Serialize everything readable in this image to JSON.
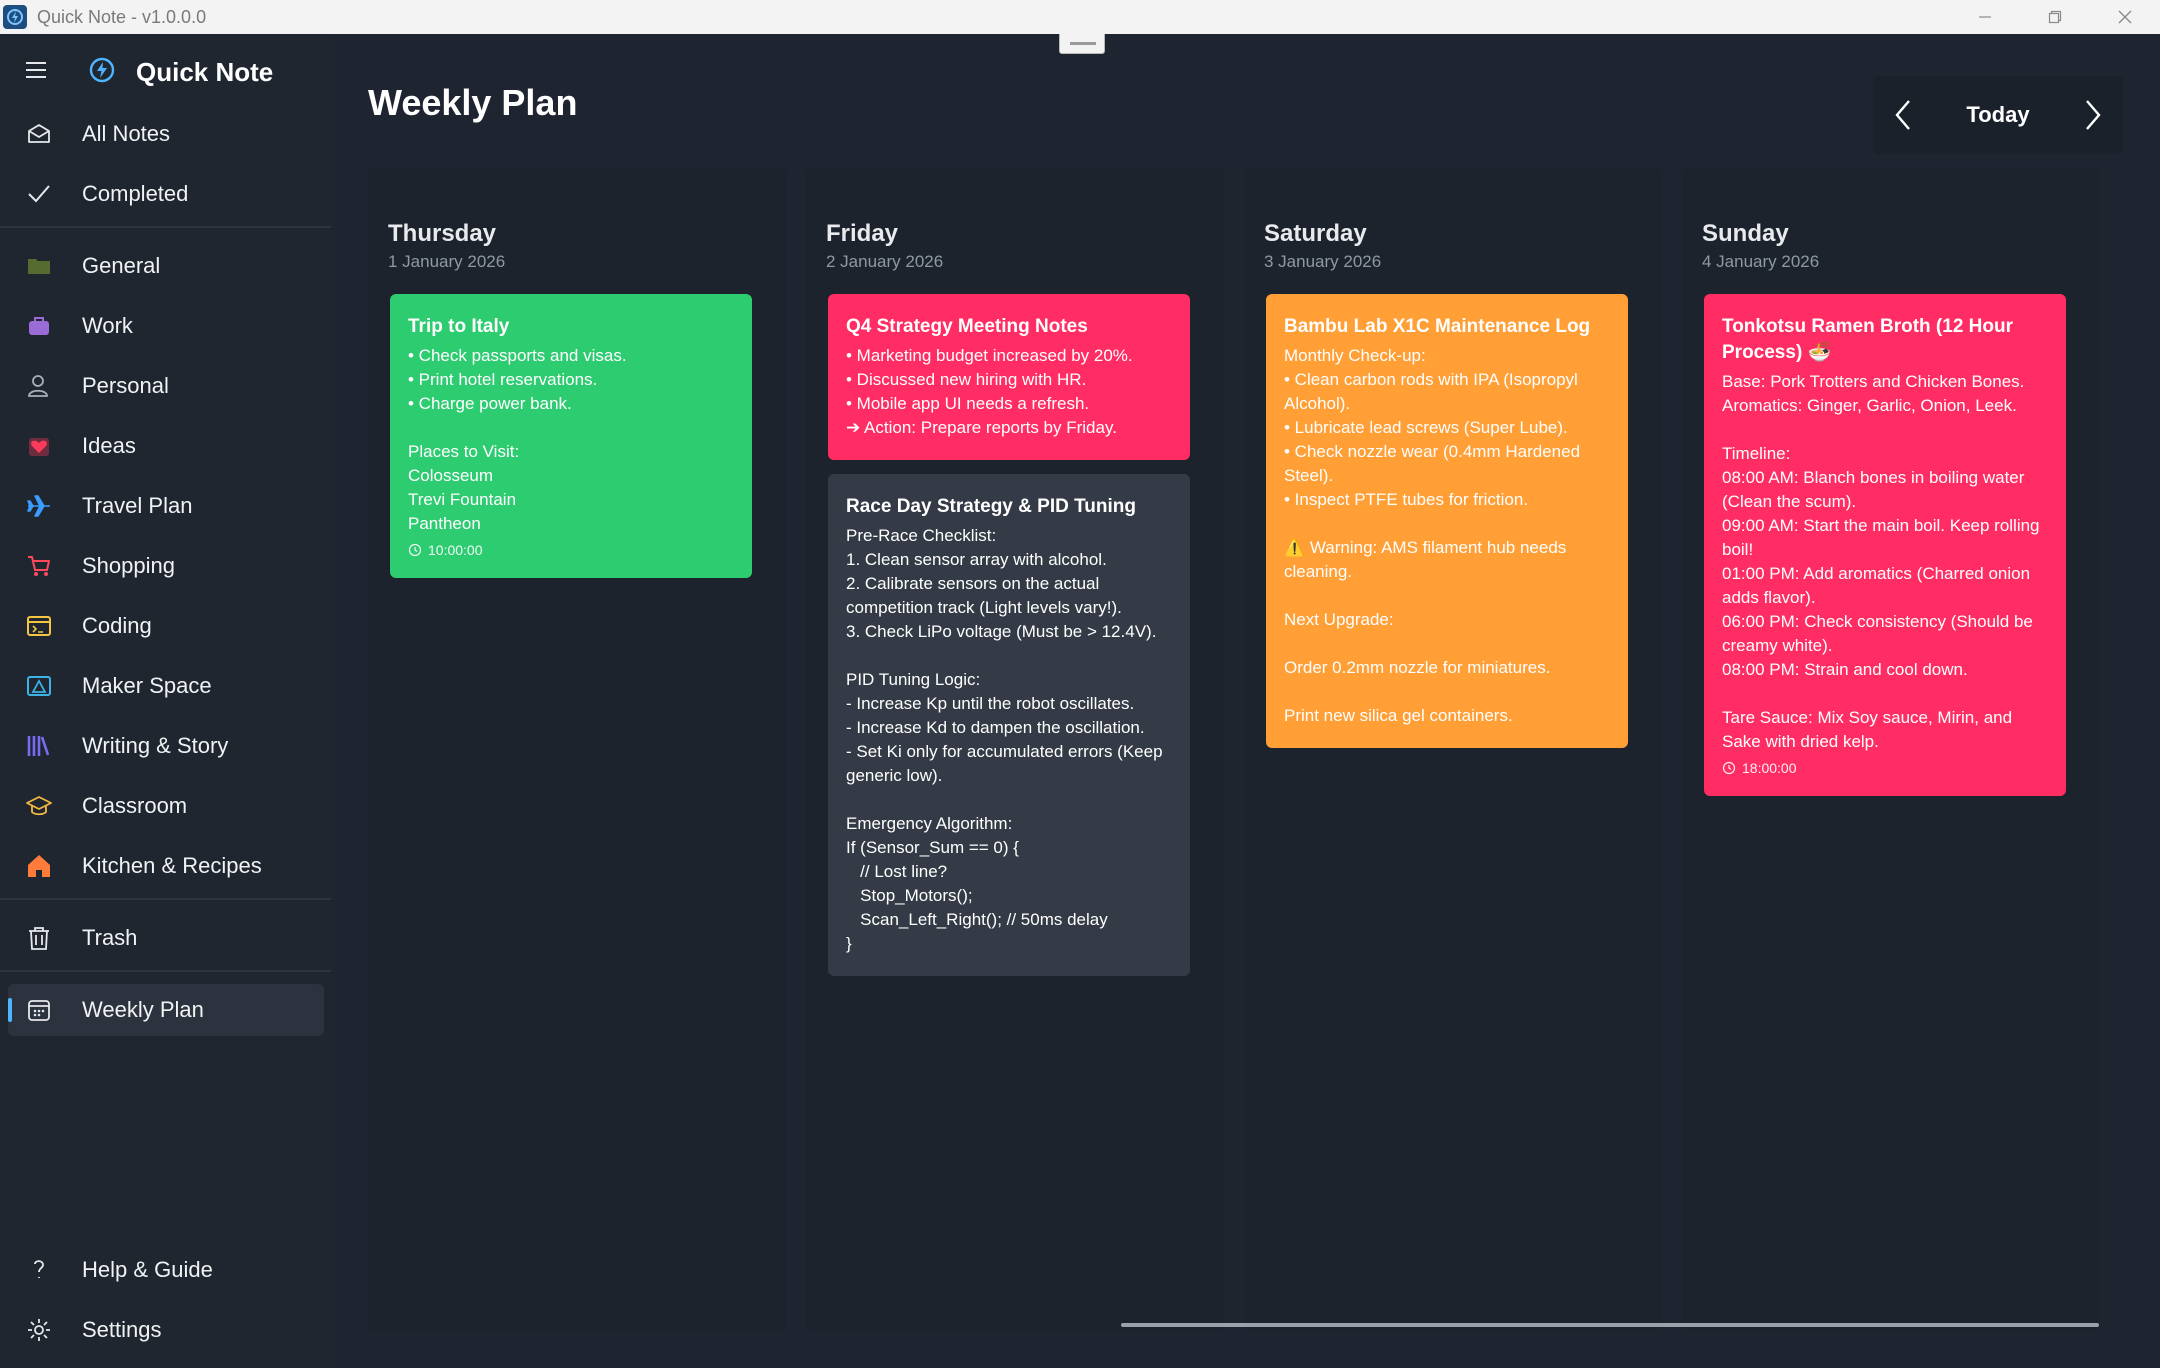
{
  "window": {
    "title": "Quick Note - v1.0.0.0"
  },
  "sidebar": {
    "brand": "Quick Note",
    "items_top": [
      {
        "label": "All Notes",
        "icon": "envelope-icon"
      },
      {
        "label": "Completed",
        "icon": "checkmark-icon"
      }
    ],
    "categories": [
      {
        "label": "General",
        "icon": "folder-icon",
        "color": "#556b2f"
      },
      {
        "label": "Work",
        "icon": "briefcase-icon",
        "color": "#9b6bd6"
      },
      {
        "label": "Personal",
        "icon": "user-icon",
        "color": "#aab0b8"
      },
      {
        "label": "Ideas",
        "icon": "heart-icon",
        "color": "#ff3b5c"
      },
      {
        "label": "Travel Plan",
        "icon": "airplane-icon",
        "color": "#3b9cff"
      },
      {
        "label": "Shopping",
        "icon": "cart-icon",
        "color": "#ff4a5a"
      },
      {
        "label": "Coding",
        "icon": "terminal-icon",
        "color": "#f5c542"
      },
      {
        "label": "Maker Space",
        "icon": "ruler-icon",
        "color": "#3bb3e6"
      },
      {
        "label": "Writing & Story",
        "icon": "books-icon",
        "color": "#7a6cf0"
      },
      {
        "label": "Classroom",
        "icon": "graduation-cap-icon",
        "color": "#f5b942"
      },
      {
        "label": "Kitchen & Recipes",
        "icon": "home-icon",
        "color": "#ff7b3a"
      }
    ],
    "trash": {
      "label": "Trash",
      "icon": "trash-icon"
    },
    "weekly": {
      "label": "Weekly Plan",
      "icon": "calendar-icon"
    },
    "help": {
      "label": "Help & Guide",
      "icon": "question-icon"
    },
    "settings": {
      "label": "Settings",
      "icon": "gear-icon"
    }
  },
  "main": {
    "title": "Weekly Plan",
    "today": "Today",
    "days": [
      {
        "day": "Thursday",
        "date": "1 January 2026",
        "notes": [
          {
            "title": "Trip to Italy",
            "body": "• Check passports and visas.\n• Print hotel reservations.\n• Charge power bank.\n\nPlaces to Visit:\nColosseum\nTrevi Fountain\nPantheon",
            "time": "10:00:00",
            "color": "#2ecc71"
          }
        ]
      },
      {
        "day": "Friday",
        "date": "2 January 2026",
        "notes": [
          {
            "title": "Q4 Strategy Meeting Notes",
            "body": "• Marketing budget increased by 20%.\n• Discussed new hiring with HR.\n• Mobile app UI needs a refresh.\n➔ Action: Prepare reports by Friday.",
            "time": "",
            "color": "#ff2d63"
          },
          {
            "title": "Race Day Strategy & PID Tuning",
            "body": "Pre-Race Checklist:\n1. Clean sensor array with alcohol.\n2. Calibrate sensors on the actual competition track (Light levels vary!).\n3. Check LiPo voltage (Must be > 12.4V).\n\nPID Tuning Logic:\n- Increase Kp until the robot oscillates.\n- Increase Kd to dampen the oscillation.\n- Set Ki only for accumulated errors (Keep generic low).\n\nEmergency Algorithm:\nIf (Sensor_Sum == 0) {\n   // Lost line?\n   Stop_Motors();\n   Scan_Left_Right(); // 50ms delay\n}",
            "time": "",
            "color": "#343b46"
          }
        ]
      },
      {
        "day": "Saturday",
        "date": "3 January 2026",
        "notes": [
          {
            "title": "Bambu Lab X1C Maintenance Log",
            "body": "Monthly Check-up:\n• Clean carbon rods with IPA (Isopropyl Alcohol).\n• Lubricate lead screws (Super Lube).\n• Check nozzle wear (0.4mm Hardened Steel).\n• Inspect PTFE tubes for friction.\n\n⚠️ Warning: AMS filament hub needs cleaning.\n\nNext Upgrade:\n\nOrder 0.2mm nozzle for miniatures.\n\nPrint new silica gel containers.",
            "time": "",
            "color": "#ff9f36"
          }
        ]
      },
      {
        "day": "Sunday",
        "date": "4 January 2026",
        "notes": [
          {
            "title": "Tonkotsu Ramen Broth (12 Hour Process) 🍜",
            "body": "Base: Pork Trotters and Chicken Bones.\nAromatics: Ginger, Garlic, Onion, Leek.\n\nTimeline:\n08:00 AM: Blanch bones in boiling water (Clean the scum).\n09:00 AM: Start the main boil. Keep rolling boil!\n01:00 PM: Add aromatics (Charred onion adds flavor).\n06:00 PM: Check consistency (Should be creamy white).\n08:00 PM: Strain and cool down.\n\nTare Sauce: Mix Soy sauce, Mirin, and Sake with dried kelp.",
            "time": "18:00:00",
            "color": "#ff2d63"
          }
        ]
      }
    ]
  }
}
